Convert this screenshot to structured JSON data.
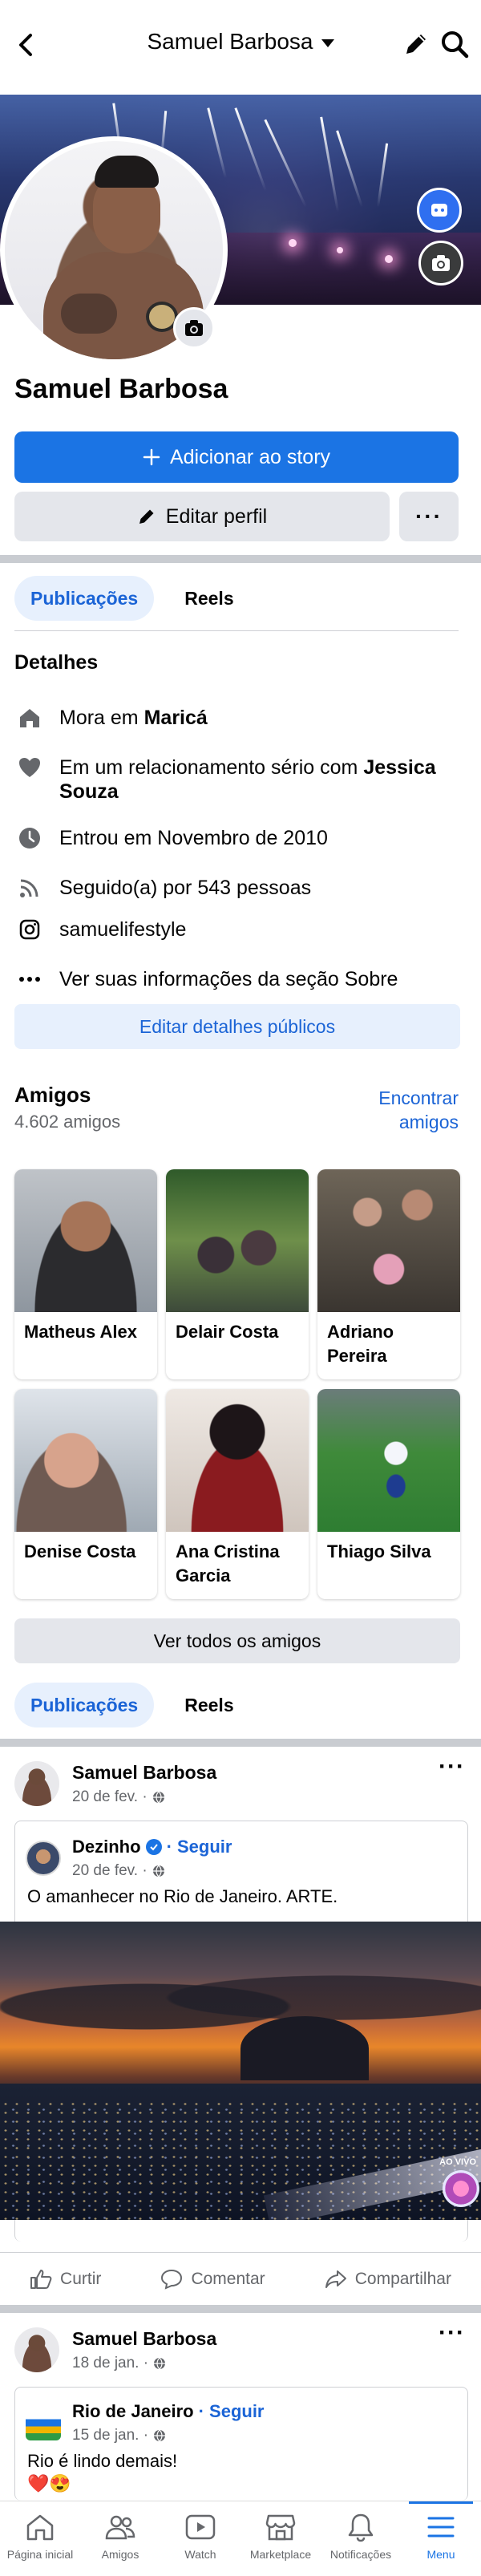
{
  "header": {
    "title": "Samuel Barbosa"
  },
  "profile": {
    "name": "Samuel Barbosa",
    "add_story_label": "Adicionar ao story",
    "edit_profile_label": "Editar perfil",
    "more_label": "···"
  },
  "tabs": [
    {
      "label": "Publicações"
    },
    {
      "label": "Reels"
    }
  ],
  "details": {
    "title": "Detalhes",
    "lives_prefix": "Mora em ",
    "lives_place": "Maricá",
    "relationship_prefix": "Em um relacionamento sério com ",
    "relationship_partner": "Jessica Souza",
    "joined": "Entrou em Novembro de 2010",
    "followers": "Seguido(a) por 543 pessoas",
    "instagram": "samuelifestyle",
    "about": "Ver suas informações da seção Sobre",
    "edit_public": "Editar detalhes públicos"
  },
  "friends": {
    "title": "Amigos",
    "count": "4.602 amigos",
    "find": "Encontrar amigos",
    "see_all": "Ver todos os amigos",
    "list": [
      {
        "name": "Matheus Alex"
      },
      {
        "name": "Delair Costa"
      },
      {
        "name": "Adriano Pereira"
      },
      {
        "name": "Denise Costa"
      },
      {
        "name": "Ana Cristina Garcia"
      },
      {
        "name": "Thiago Silva"
      }
    ]
  },
  "posts": [
    {
      "author": "Samuel Barbosa",
      "date": "20 de fev. ·",
      "shared": {
        "author": "Dezinho",
        "follow": "· Seguir",
        "date": "20 de fev. ·",
        "text": "O amanhecer no Rio de Janeiro. ARTE."
      },
      "video_badge": "AO VIVO"
    },
    {
      "author": "Samuel Barbosa",
      "date": "18 de jan. ·",
      "shared": {
        "author": "Rio de Janeiro",
        "follow": "· Seguir",
        "date": "15 de jan. ·",
        "text": "Rio é lindo demais!",
        "emoji": "❤️😍"
      }
    }
  ],
  "post_actions": {
    "like": "Curtir",
    "comment": "Comentar",
    "share": "Compartilhar"
  },
  "bottom_nav": [
    {
      "label": "Página inicial",
      "icon": "home-icon"
    },
    {
      "label": "Amigos",
      "icon": "friends-icon"
    },
    {
      "label": "Watch",
      "icon": "watch-icon"
    },
    {
      "label": "Marketplace",
      "icon": "marketplace-icon"
    },
    {
      "label": "Notificações",
      "icon": "bell-icon"
    },
    {
      "label": "Menu",
      "icon": "menu-icon"
    }
  ],
  "colors": {
    "accent": "#1b74e4",
    "accent_light": "#e7f0fd",
    "button_grey": "#e4e6eb",
    "text_secondary": "#65676b"
  }
}
